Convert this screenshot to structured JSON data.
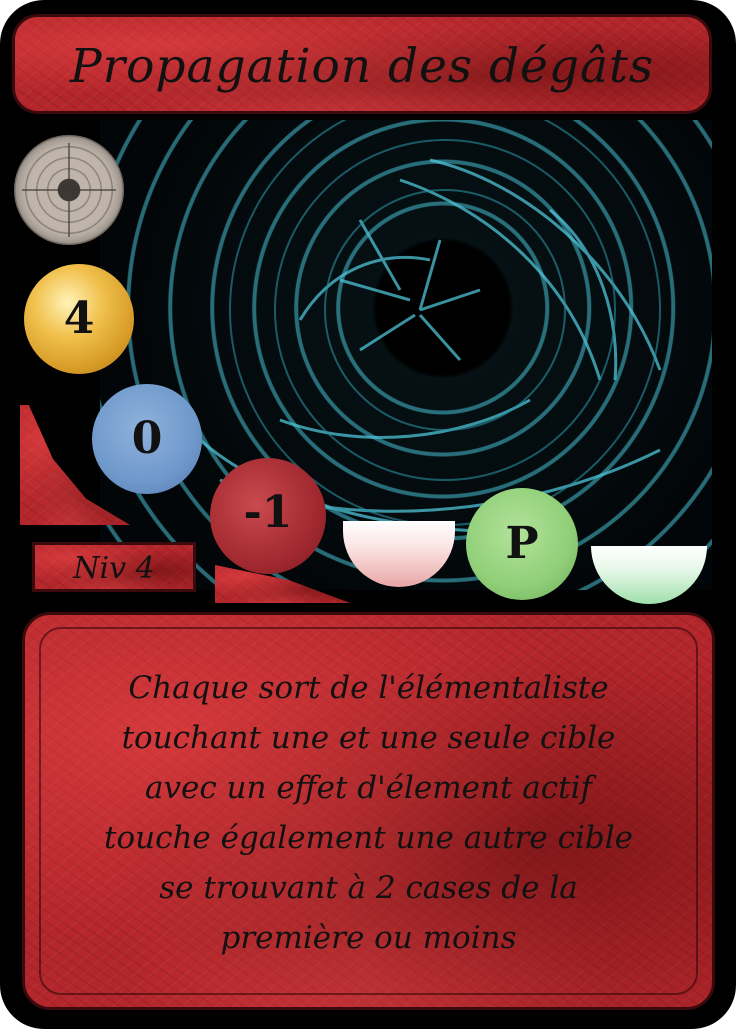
{
  "card": {
    "title": "Propagation des dégâts",
    "level_label": "Niv 4",
    "stats": {
      "gold_value": "4",
      "blue_value": "0",
      "red_value": "-1",
      "green_value": "P"
    },
    "icons": [
      "target-icon"
    ],
    "description": "Chaque sort de l'élémentaliste\ntouchant une et une seule cible\navec un effet d'élement actif\ntouche également une autre cible\nse trouvant à 2 cases de la\npremière ou moins"
  },
  "colors": {
    "card_red": "#b3262b",
    "gold": "#f1c14e",
    "blue": "#6f98cb",
    "red": "#a22a30",
    "green": "#90cf78",
    "art_glow": "#46bed2"
  }
}
